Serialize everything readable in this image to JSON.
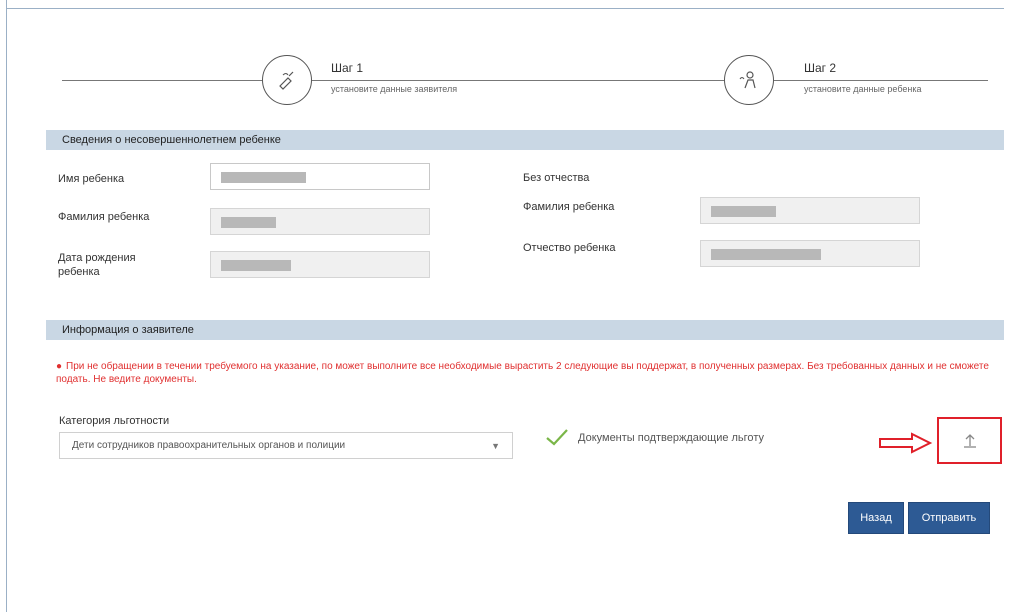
{
  "stepper": {
    "steps": [
      {
        "title": "Шаг 1",
        "subtitle": "установите данные заявителя",
        "icon": "hand-pen-icon"
      },
      {
        "title": "Шаг 2",
        "subtitle": "установите данные ребенка",
        "icon": "child-icon"
      }
    ]
  },
  "child_section": {
    "header": "Сведения о несовершеннолетнем ребенке",
    "fields": {
      "name": {
        "label": "Имя ребенка"
      },
      "surname": {
        "label": "Фамилия ребенка"
      },
      "birth_date": {
        "label": "Дата рождения ребенка"
      },
      "no_patronymic": {
        "label": "Без отчества"
      },
      "surname_right": {
        "label": "Фамилия ребенка"
      },
      "patronymic": {
        "label": "Отчество ребенка"
      }
    }
  },
  "placement_section": {
    "header": "Информация о заявителе",
    "error_icon": "warning-circle-icon",
    "error_text": "При не обращении в течении требуемого на указание, по может выполните все необходимые вырастить 2 следующие вы поддержат, в полученных размерах. Без требованных данных и не сможете подать. Не ведите документы.",
    "category_label": "Категория льготности",
    "category_value": "Дети сотрудников правоохранительных органов и полиции",
    "check_text": "Документы подтверждающие льготу",
    "upload_icon": "upload-icon",
    "arrow_icon": "arrow-right-icon"
  },
  "buttons": {
    "back": "Назад",
    "next": "Отправить"
  },
  "colors": {
    "section_bar": "#c9d7e4",
    "primary_button": "#2d5a94",
    "error": "#e03030",
    "highlight": "#e0202a",
    "check": "#7ab648"
  }
}
